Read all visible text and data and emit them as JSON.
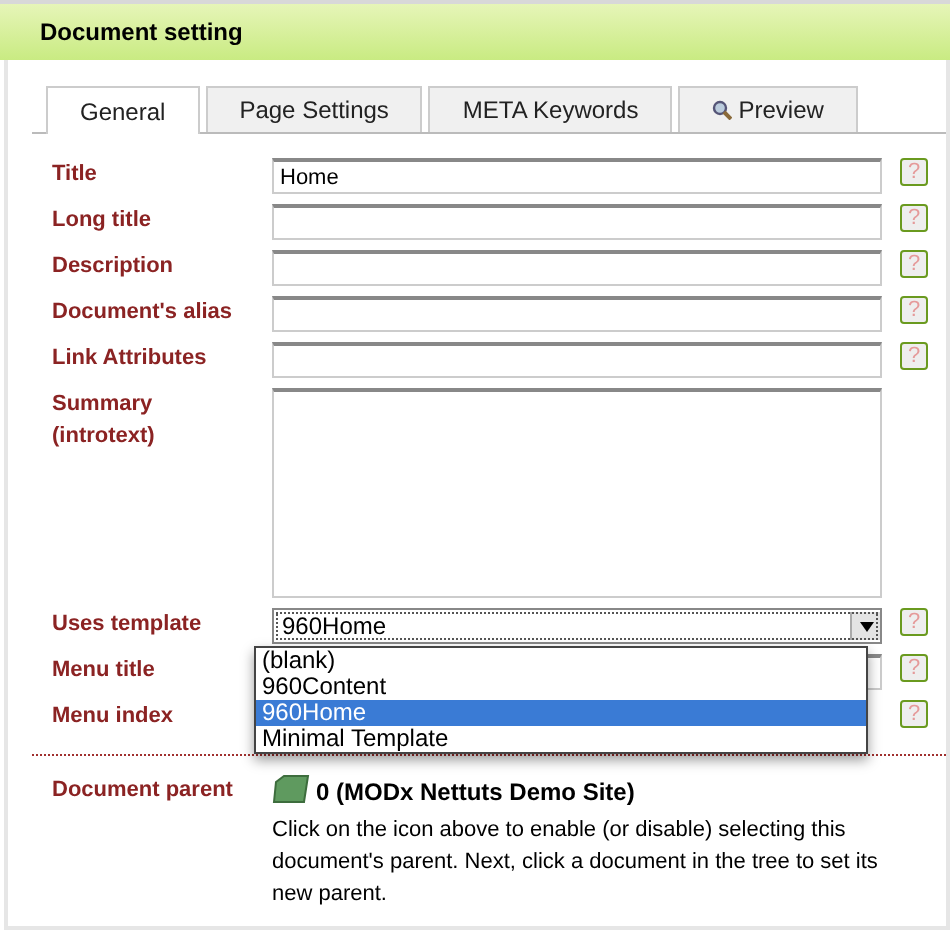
{
  "panel": {
    "title": "Document setting"
  },
  "tabs": [
    {
      "label": "General",
      "selected": true,
      "kind": "text"
    },
    {
      "label": "Page Settings",
      "selected": false,
      "kind": "text"
    },
    {
      "label": "META Keywords",
      "selected": false,
      "kind": "text"
    },
    {
      "label": "Preview",
      "selected": false,
      "kind": "search"
    }
  ],
  "fields": [
    {
      "label": "Title",
      "kind": "input",
      "value": "Home",
      "help": "?"
    },
    {
      "label": "Long title",
      "kind": "input",
      "help": "?"
    },
    {
      "label": "Description",
      "kind": "input",
      "help": "?"
    },
    {
      "label": "Document's alias",
      "kind": "input",
      "help": "?"
    },
    {
      "label": "Link Attributes",
      "kind": "input",
      "help": "?"
    },
    {
      "label": "Summary (introtext)",
      "kind": "textarea"
    },
    {
      "label": "Uses template",
      "kind": "select",
      "value": "960Home",
      "help": "?",
      "expanded": true,
      "options": [
        {
          "label": "(blank)",
          "selected": false
        },
        {
          "label": "960Content",
          "selected": false
        },
        {
          "label": "960Home",
          "selected": true
        },
        {
          "label": "Minimal Template",
          "selected": false
        }
      ]
    },
    {
      "label": "Menu title",
      "kind": "input",
      "help": "?"
    },
    {
      "label": "Menu index",
      "kind": "short",
      "help": "?"
    }
  ],
  "parent": {
    "label": "Document parent",
    "name": "0 (MODx Nettuts Demo Site)",
    "note": "Click on the icon above to enable (or disable) selecting this document's parent. Next, click a document in the tree to set its new parent."
  }
}
